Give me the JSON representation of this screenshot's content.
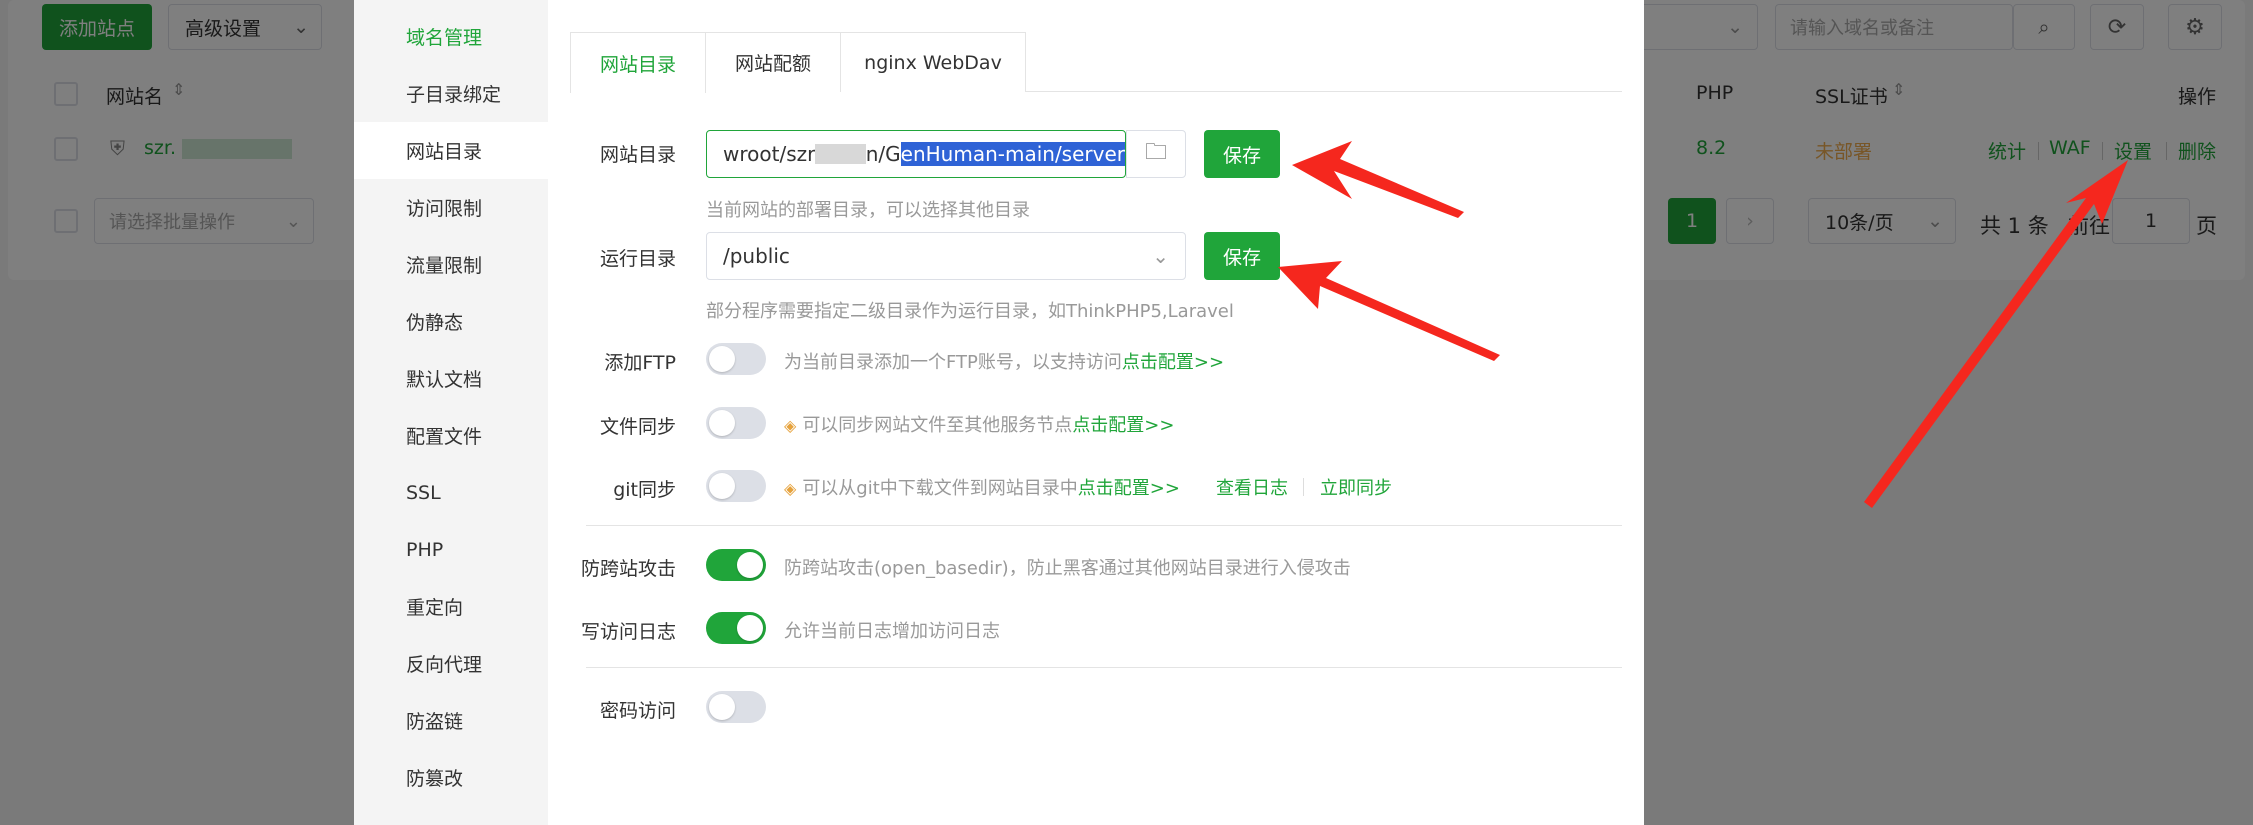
{
  "background": {
    "add_site": "添加站点",
    "advanced": "高级设置",
    "search_placeholder": "请输入域名或备注",
    "col_site": "网站名",
    "col_php": "PHP",
    "col_ssl": "SSL证书",
    "col_ops": "操作",
    "row": {
      "name": "szr.",
      "php": "8.2",
      "ssl": "未部署",
      "stats": "统计",
      "waf": "WAF",
      "settings": "设置",
      "delete": "删除"
    },
    "batch_placeholder": "请选择批量操作",
    "page": "1",
    "per_page": "10条/页",
    "total": "共 1 条",
    "goto_prefix": "前往",
    "goto_value": "1",
    "goto_suffix": "页"
  },
  "modal": {
    "sidebar": [
      "域名管理",
      "子目录绑定",
      "网站目录",
      "访问限制",
      "流量限制",
      "伪静态",
      "默认文档",
      "配置文件",
      "SSL",
      "PHP",
      "重定向",
      "反向代理",
      "防盗链",
      "防篡改"
    ],
    "tabs": [
      "网站目录",
      "网站配额",
      "nginx WebDav"
    ],
    "site_dir": {
      "label": "网站目录",
      "value_prefix": "wroot/szr",
      "value_mid": "n/G",
      "value_selected": "enHuman-main/server",
      "save": "保存",
      "hint": "当前网站的部署目录，可以选择其他目录"
    },
    "run_dir": {
      "label": "运行目录",
      "value": "/public",
      "save": "保存",
      "hint": "部分程序需要指定二级目录作为运行目录，如ThinkPHP5,Laravel"
    },
    "ftp": {
      "label": "添加FTP",
      "hint": "为当前目录添加一个FTP账号，以支持访问",
      "link": "点击配置>>"
    },
    "file_sync": {
      "label": "文件同步",
      "hint": "可以同步网站文件至其他服务节点",
      "link": "点击配置>>"
    },
    "git_sync": {
      "label": "git同步",
      "hint": "可以从git中下载文件到网站目录中",
      "link": "点击配置>>",
      "log": "查看日志",
      "sync_now": "立即同步"
    },
    "anti_xss": {
      "label": "防跨站攻击",
      "hint": "防跨站攻击(open_basedir)，防止黑客通过其他网站目录进行入侵攻击"
    },
    "access_log": {
      "label": "写访问日志",
      "hint": "允许当前日志增加访问日志"
    },
    "password": {
      "label": "密码访问"
    }
  },
  "colors": {
    "accent": "#20a53a",
    "arrow": "#f5271e",
    "selection": "#2f63d6"
  }
}
